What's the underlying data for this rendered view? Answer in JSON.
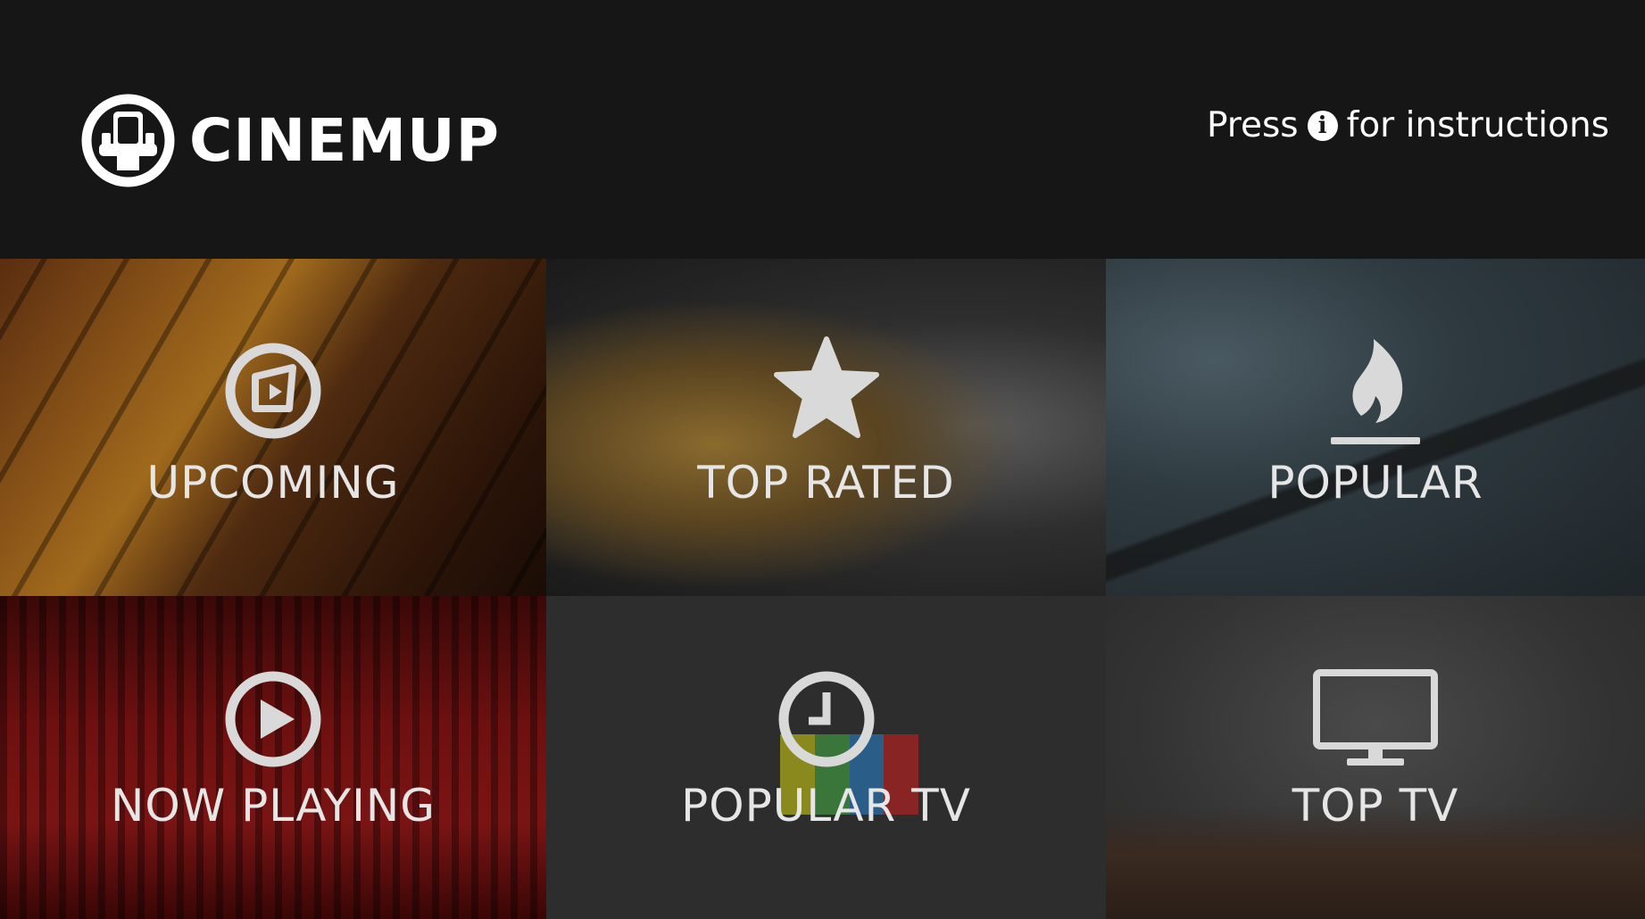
{
  "app": {
    "name": "CINEMUP",
    "hint_prefix": "Press",
    "hint_suffix": "for instructions"
  },
  "tiles": [
    {
      "label": "UPCOMING",
      "icon": "upcoming-icon"
    },
    {
      "label": "TOP RATED",
      "icon": "star-icon"
    },
    {
      "label": "POPULAR",
      "icon": "flame-icon"
    },
    {
      "label": "NOW PLAYING",
      "icon": "play-icon"
    },
    {
      "label": "POPULAR TV",
      "icon": "clock-icon"
    },
    {
      "label": "TOP TV",
      "icon": "monitor-icon"
    }
  ],
  "colors": {
    "background": "#161616",
    "icon": "#d9d9d9",
    "text": "#e6e6e6"
  }
}
